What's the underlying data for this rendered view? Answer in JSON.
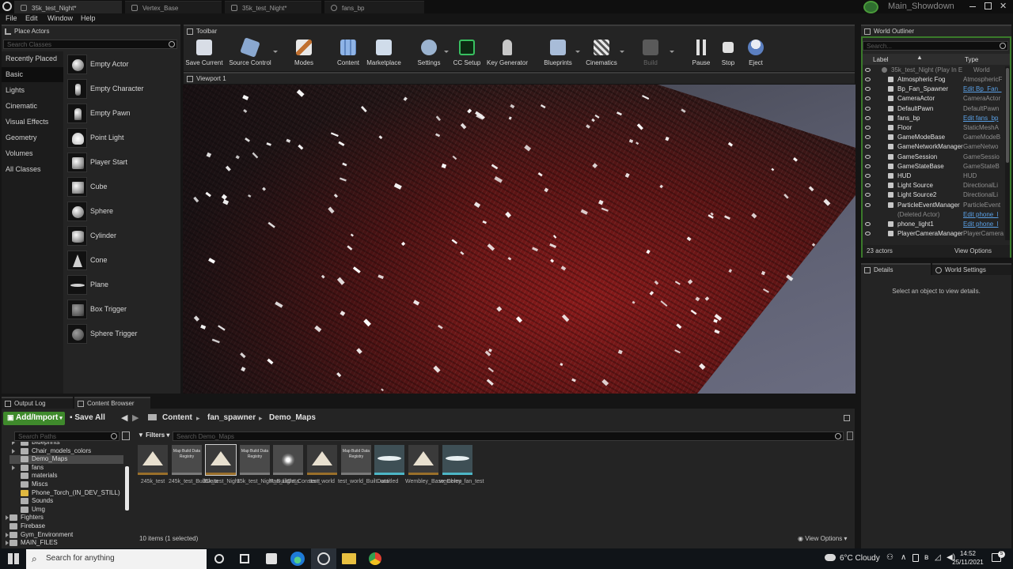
{
  "title_bar": {
    "tabs": [
      {
        "label": "35k_test_Night*",
        "active": true
      },
      {
        "label": "Vertex_Base",
        "active": false
      },
      {
        "label": "35k_test_Night*",
        "active": false
      },
      {
        "label": "fans_bp",
        "active": false
      }
    ],
    "project_name": "Main_Showdown"
  },
  "menu": [
    "File",
    "Edit",
    "Window",
    "Help"
  ],
  "place_actors": {
    "tab_label": "Place Actors",
    "search_placeholder": "Search Classes",
    "categories": [
      "Recently Placed",
      "Basic",
      "Lights",
      "Cinematic",
      "Visual Effects",
      "Geometry",
      "Volumes",
      "All Classes"
    ],
    "selected_category": "Basic",
    "actors": [
      "Empty Actor",
      "Empty Character",
      "Empty Pawn",
      "Point Light",
      "Player Start",
      "Cube",
      "Sphere",
      "Cylinder",
      "Cone",
      "Plane",
      "Box Trigger",
      "Sphere Trigger"
    ]
  },
  "toolbar": {
    "tab_label": "Toolbar",
    "buttons": [
      "Save Current",
      "Source Control",
      "Modes",
      "Content",
      "Marketplace",
      "Settings",
      "CC Setup",
      "Key Generator",
      "Blueprints",
      "Cinematics",
      "Build",
      "Pause",
      "Stop",
      "Eject"
    ]
  },
  "viewport": {
    "tab_label": "Viewport 1"
  },
  "world_outliner": {
    "tab_label": "World Outliner",
    "search_placeholder": "Search...",
    "col_label": "Label",
    "col_type": "Type",
    "root": {
      "name": "35k_test_Night (Play In E",
      "type": "World"
    },
    "rows": [
      {
        "name": "Atmospheric Fog",
        "type": "AtmosphericF"
      },
      {
        "name": "Bp_Fan_Spawner",
        "type": "Edit Bp_Fan_",
        "link": true
      },
      {
        "name": "CameraActor",
        "type": "CameraActor"
      },
      {
        "name": "DefaultPawn",
        "type": "DefaultPawn"
      },
      {
        "name": "fans_bp",
        "type": "Edit fans_bp",
        "link": true
      },
      {
        "name": "Floor",
        "type": "StaticMeshA"
      },
      {
        "name": "GameModeBase",
        "type": "GameModeB"
      },
      {
        "name": "GameNetworkManager",
        "type": "GameNetwo"
      },
      {
        "name": "GameSession",
        "type": "GameSessio"
      },
      {
        "name": "GameStateBase",
        "type": "GameStateB"
      },
      {
        "name": "HUD",
        "type": "HUD"
      },
      {
        "name": "Light Source",
        "type": "DirectionalLi"
      },
      {
        "name": "Light Source2",
        "type": "DirectionalLi"
      },
      {
        "name": "ParticleEventManager",
        "type": "ParticleEvent"
      },
      {
        "name": "(Deleted Actor)",
        "type": "Edit phone_l",
        "link": true,
        "deleted": true
      },
      {
        "name": "phone_light1",
        "type": "Edit phone_l",
        "link": true
      },
      {
        "name": "PlayerCameraManager",
        "type": "PlayerCamera"
      }
    ],
    "count": "23 actors",
    "view_options": "View Options"
  },
  "details": {
    "tab_label": "Details",
    "world_settings_label": "World Settings",
    "empty_message": "Select an object to view details."
  },
  "bottom": {
    "output_log_tab": "Output Log",
    "content_browser_tab": "Content Browser",
    "add_import": "Add/Import",
    "save_all": "Save All",
    "breadcrumb": [
      "Content",
      "fan_spawner",
      "Demo_Maps"
    ],
    "search_paths_placeholder": "Search Paths",
    "filters_label": "Filters",
    "search_assets_placeholder": "Search Demo_Maps",
    "tree": [
      {
        "label": "Blueprints",
        "depth": 1,
        "arrow": true
      },
      {
        "label": "Chair_models_colors",
        "depth": 1,
        "arrow": true
      },
      {
        "label": "Demo_Maps",
        "depth": 1,
        "selected": true
      },
      {
        "label": "fans",
        "depth": 1,
        "arrow": true
      },
      {
        "label": "materials",
        "depth": 1
      },
      {
        "label": "Miscs",
        "depth": 1
      },
      {
        "label": "Phone_Torch_(IN_DEV_STILL)",
        "depth": 1,
        "open": true
      },
      {
        "label": "Sounds",
        "depth": 1
      },
      {
        "label": "Umg",
        "depth": 1
      },
      {
        "label": "Fighters",
        "depth": 0,
        "arrow": true
      },
      {
        "label": "Firebase",
        "depth": 0
      },
      {
        "label": "Gym_Environment",
        "depth": 0,
        "arrow": true
      },
      {
        "label": "MAIN_FILES",
        "depth": 0,
        "arrow": true
      }
    ],
    "assets": [
      {
        "label": "245k_test",
        "kind": "map"
      },
      {
        "label": "245k_test_BuiltData",
        "kind": "registry",
        "thumb_text": "Map Build Data Registry"
      },
      {
        "label": "35k_test_Night",
        "kind": "map",
        "selected": true
      },
      {
        "label": "35k_test_Night_BuiltData",
        "kind": "registry",
        "thumb_text": "Map Build Data Registry"
      },
      {
        "label": "Fan_Light_Constant",
        "kind": "light"
      },
      {
        "label": "test_world",
        "kind": "map"
      },
      {
        "label": "test_world_BuiltData",
        "kind": "registry",
        "thumb_text": "Map Build Data Registry"
      },
      {
        "label": "untitled",
        "kind": "material"
      },
      {
        "label": "Wembley_Base_Demo",
        "kind": "map"
      },
      {
        "label": "wembley_fan_test",
        "kind": "material"
      }
    ],
    "status": "10 items (1 selected)",
    "view_options": "View Options"
  },
  "taskbar": {
    "search_placeholder": "Search for anything",
    "weather": "6°C  Cloudy",
    "time": "14:52",
    "date": "25/11/2021"
  }
}
